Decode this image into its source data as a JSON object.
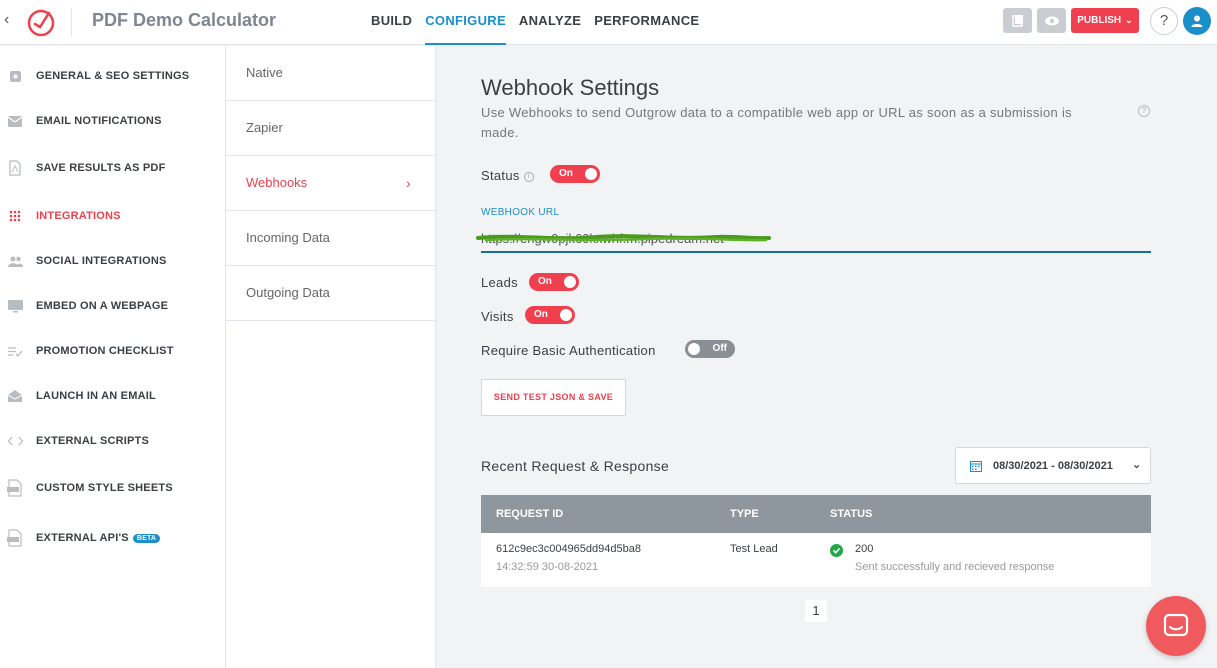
{
  "header": {
    "app_title": "PDF Demo Calculator",
    "nav": [
      {
        "label": "BUILD",
        "active": false
      },
      {
        "label": "CONFIGURE",
        "active": true
      },
      {
        "label": "ANALYZE",
        "active": false
      },
      {
        "label": "PERFORMANCE",
        "active": false
      }
    ],
    "publish_label": "PUBLISH",
    "help_label": "?"
  },
  "sidebar": {
    "items": [
      {
        "label": "GENERAL & SEO SETTINGS",
        "icon": "settings-icon"
      },
      {
        "label": "EMAIL NOTIFICATIONS",
        "icon": "mail-icon"
      },
      {
        "label": "SAVE RESULTS AS PDF",
        "icon": "pdf-icon"
      },
      {
        "label": "INTEGRATIONS",
        "icon": "grid-dots-icon",
        "active": true
      },
      {
        "label": "SOCIAL INTEGRATIONS",
        "icon": "people-icon"
      },
      {
        "label": "EMBED ON A WEBPAGE",
        "icon": "monitor-icon"
      },
      {
        "label": "PROMOTION CHECKLIST",
        "icon": "checklist-icon"
      },
      {
        "label": "LAUNCH IN AN EMAIL",
        "icon": "envelope-open-icon"
      },
      {
        "label": "EXTERNAL SCRIPTS",
        "icon": "code-icon"
      },
      {
        "label": "CUSTOM STYLE SHEETS",
        "icon": "css-file-icon"
      },
      {
        "label": "EXTERNAL API'S",
        "icon": "api-file-icon",
        "badge": "BETA"
      }
    ]
  },
  "subnav": {
    "items": [
      {
        "label": "Native"
      },
      {
        "label": "Zapier"
      },
      {
        "label": "Webhooks",
        "active": true
      },
      {
        "label": "Incoming Data"
      },
      {
        "label": "Outgoing Data"
      }
    ]
  },
  "main": {
    "title": "Webhook Settings",
    "description": "Use Webhooks to send Outgrow data to a compatible web app or URL as soon as a submission is made.",
    "status_label": "Status",
    "status_toggle": "On",
    "webhook_url_label": "WEBHOOK URL",
    "webhook_url_value": "https://engw0pjk60kxwhf.m.pipedream.net",
    "leads_label": "Leads",
    "leads_toggle": "On",
    "visits_label": "Visits",
    "visits_toggle": "On",
    "auth_label": "Require Basic Authentication",
    "auth_toggle": "Off",
    "send_button": "SEND TEST JSON & SAVE",
    "recent_title": "Recent Request & Response",
    "date_range": "08/30/2021 - 08/30/2021",
    "table": {
      "headers": [
        "REQUEST ID",
        "TYPE",
        "STATUS"
      ],
      "rows": [
        {
          "request_id": "612c9ec3c004965dd94d5ba8",
          "timestamp": "14:32:59 30-08-2021",
          "type": "Test Lead",
          "status_code": "200",
          "status_text": "Sent successfully and recieved response"
        }
      ]
    },
    "page_number": "1"
  },
  "colors": {
    "accent_red": "#f0404f",
    "accent_blue": "#1a8fc9",
    "success_green": "#21a846"
  }
}
